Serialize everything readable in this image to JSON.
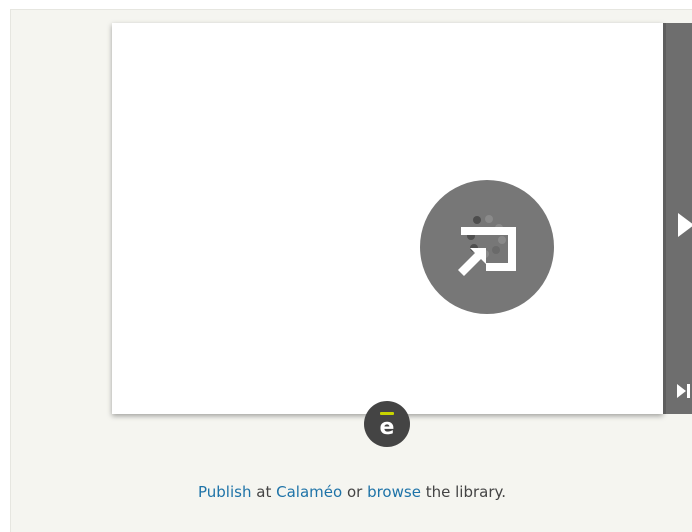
{
  "viewer": {
    "loader_icon": "publish-loader-icon",
    "next_icon": "next-page-icon",
    "last_icon": "last-page-icon",
    "badge_icon": "calameo-logo-icon",
    "badge_text": "ē"
  },
  "footer": {
    "publish_link": "Publish",
    "text_at": "at",
    "calameo_link": "Calaméo",
    "text_or": "or",
    "browse_link": "browse",
    "text_end": "the library."
  },
  "colors": {
    "link": "#1e73a8",
    "background": "#f5f5f0",
    "panel": "#6e6e6e",
    "loader": "#777777",
    "badge": "#444444",
    "badge_accent": "#c8d400"
  }
}
